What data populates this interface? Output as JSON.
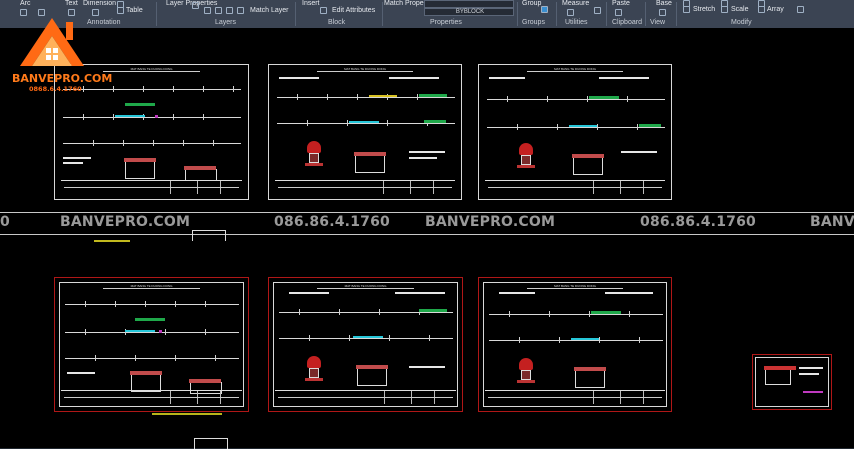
{
  "ribbon": {
    "row1": {
      "arc": "Arc",
      "text": "Text",
      "dimension": "Dimension",
      "layer_properties": "Layer Properties",
      "match_layer": "Match Layer",
      "insert": "Insert",
      "edit_attributes": "Edit Attributes",
      "match_properties": "Match Properties",
      "linetype_select": "BYBLOCK",
      "group": "Group",
      "measure": "Measure",
      "paste": "Paste",
      "base": "Base",
      "table": "Table",
      "stretch": "Stretch",
      "scale": "Scale",
      "array": "Array"
    },
    "groups": {
      "annotation": "Annotation",
      "layers": "Layers",
      "block": "Block",
      "properties": "Properties",
      "groups": "Groups",
      "utilities": "Utilities",
      "clipboard": "Clipboard",
      "view": "View",
      "modify": "Modify"
    }
  },
  "watermark": {
    "brand": "BANVEPRO.COM",
    "phone": "086.86.4.1760",
    "logo_brand": "BANVEPRO.COM",
    "logo_phone": "0868.6.4.1760",
    "left_fragment": "0",
    "right_fragment": "BANVE"
  },
  "colors": {
    "ribbon_bg": "#3b4453",
    "canvas_bg": "#000000",
    "sheet_border_top": "#d7d7d7",
    "sheet_border_bottom": "#b01717",
    "accent_orange": "#ff7a1a",
    "watermark_grey": "#9a9a9a"
  },
  "drawings": {
    "top_row": [
      {
        "title": "MAT BANG TE DUONG DONG"
      },
      {
        "title": "MAT BANG TE DUONG DONG"
      },
      {
        "title": "MAT BANG TE DUONG DONG"
      }
    ],
    "bottom_row": [
      {
        "title": "MAT BANG TE DUONG DONG"
      },
      {
        "title": "MAT BANG TE DUONG DONG"
      },
      {
        "title": "MAT BANG TE DUONG DONG"
      }
    ]
  }
}
